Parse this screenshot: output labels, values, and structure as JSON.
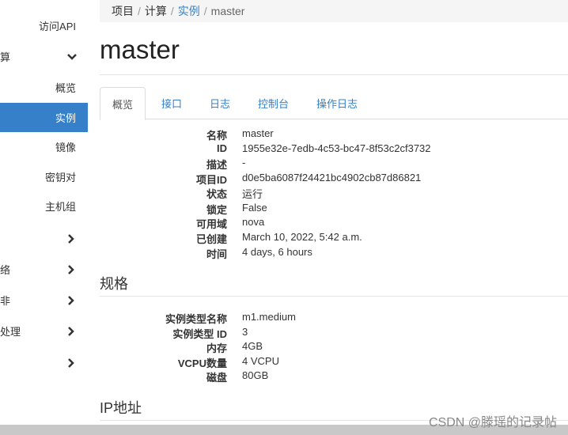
{
  "sidebar": {
    "items": [
      {
        "label": "访问API"
      },
      {
        "label": "算"
      },
      {
        "label": "概览"
      },
      {
        "label": "实例"
      },
      {
        "label": "镜像"
      },
      {
        "label": "密钥对"
      },
      {
        "label": "主机组"
      },
      {
        "label": ""
      },
      {
        "label": "络"
      },
      {
        "label": "非"
      },
      {
        "label": "处理"
      },
      {
        "label": ""
      }
    ]
  },
  "breadcrumb": [
    "项目",
    "计算",
    "实例",
    "master"
  ],
  "page_title": "master",
  "tabs": [
    "概览",
    "接口",
    "日志",
    "控制台",
    "操作日志"
  ],
  "overview": {
    "rows": [
      {
        "label": "名称",
        "value": "master"
      },
      {
        "label": "ID",
        "value": "1955e32e-7edb-4c53-bc47-8f53c2cf3732"
      },
      {
        "label": "描述",
        "value": "-"
      },
      {
        "label": "项目ID",
        "value": "d0e5ba6087f24421bc4902cb87d86821"
      },
      {
        "label": "状态",
        "value": "运行"
      },
      {
        "label": "锁定",
        "value": "False"
      },
      {
        "label": "可用域",
        "value": "nova"
      },
      {
        "label": "已创建",
        "value": "March 10, 2022, 5:42 a.m."
      },
      {
        "label": "时间",
        "value": "4 days, 6 hours"
      }
    ]
  },
  "spec": {
    "heading": "规格",
    "rows": [
      {
        "label": "实例类型名称",
        "value": "m1.medium"
      },
      {
        "label": "实例类型 ID",
        "value": "3"
      },
      {
        "label": "内存",
        "value": "4GB"
      },
      {
        "label": "VCPU数量",
        "value": "4 VCPU"
      },
      {
        "label": "磁盘",
        "value": "80GB"
      }
    ]
  },
  "ip": {
    "heading": "IP地址"
  },
  "watermark": "CSDN @滕瑶的记录帖",
  "colors": {
    "accent": "#3580c8",
    "active_bg": "#3580c8"
  }
}
